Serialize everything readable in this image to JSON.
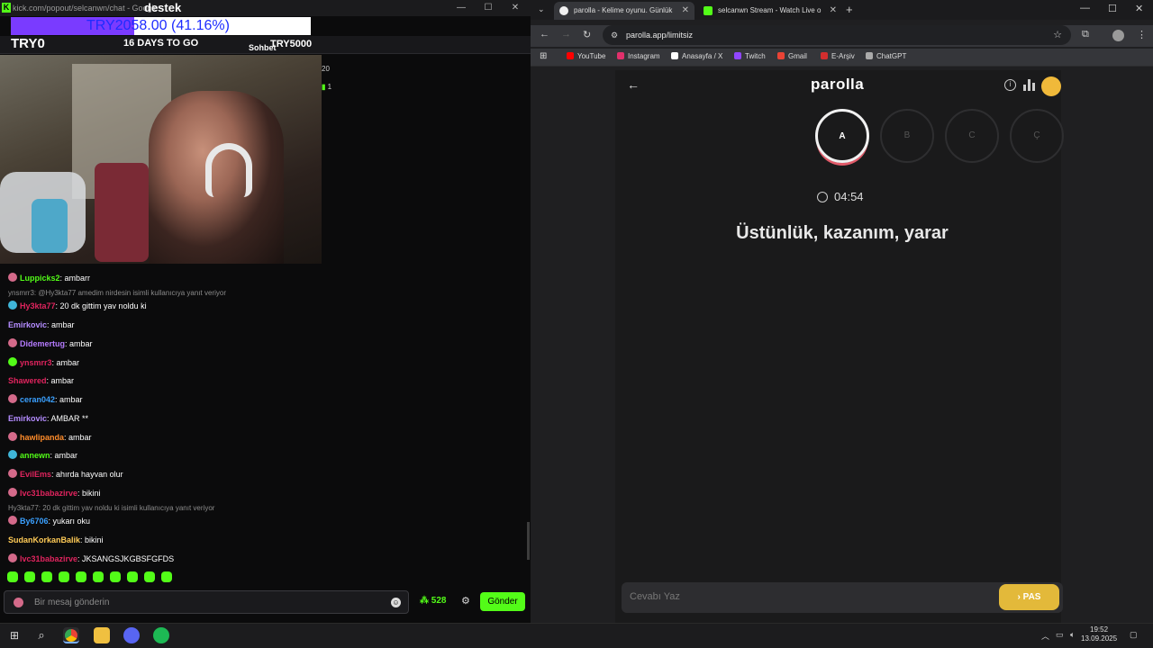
{
  "left_window": {
    "title": "kick.com/popout/selcanwn/chat - Google",
    "overlay": {
      "destek": "destek",
      "goal_text": "TRY2058.00 (41.16%)",
      "goal_progress": 0.4116,
      "left_amount": "TRY0",
      "days_left": "16 DAYS TO GO",
      "chat_label": "Sohbet",
      "goal_amount": "TRY5000"
    },
    "side_stub": {
      "top": "20",
      "count": "1"
    },
    "chat": {
      "messages": [
        {
          "user": "Luppicks2",
          "text": ": ambarr",
          "color": "#53fc18",
          "badge": "#d46a8a"
        },
        {
          "reply": "ynsmrr3: @Hy3kta77 amedim nirdesin isimli kullanıcıya yanıt veriyor"
        },
        {
          "user": "Hy3kta77",
          "text": ": 20 dk gittim yav noldu ki",
          "color": "#e0245e",
          "badge": "#3fb5d8"
        },
        {
          "user": "Emirkovic",
          "text": ": ambar",
          "color": "#b48cff",
          "badge": ""
        },
        {
          "user": "Didemertug",
          "text": ": ambar",
          "color": "#b57bff",
          "badge": "#d46a8a"
        },
        {
          "user": "ynsmrr3",
          "text": ": ambar",
          "color": "#e0245e",
          "badge": "#53fc18"
        },
        {
          "user": "Shawered",
          "text": ": ambar",
          "color": "#e0245e",
          "badge": ""
        },
        {
          "user": "ceran042",
          "text": ": ambar",
          "color": "#3aa0ff",
          "badge": "#d46a8a"
        },
        {
          "user": "Emirkovic",
          "text": ": AMBAR **",
          "color": "#b48cff",
          "badge": ""
        },
        {
          "user": "hawlipanda",
          "text": ": ambar",
          "color": "#ff8c2a",
          "badge": "#d46a8a"
        },
        {
          "user": "annewn",
          "text": ": ambar",
          "color": "#53fc18",
          "badge": "#3fb5d8"
        },
        {
          "user": "EvilEms",
          "text": ": ahırda hayvan olur",
          "color": "#e0245e",
          "badge": "#d46a8a"
        },
        {
          "user": "lvc31babazirve",
          "text": ": bikini",
          "color": "#e0245e",
          "badge": "#d46a8a"
        },
        {
          "reply": "Hy3kta77: 20 dk gittim yav noldu ki isimli kullanıcıya yanıt veriyor"
        },
        {
          "user": "By6706",
          "text": ": yukarı oku",
          "color": "#3aa0ff",
          "badge": "#d46a8a"
        },
        {
          "user": "SudanKorkanBalik",
          "text": ": bikini",
          "color": "#ffcb57",
          "badge": ""
        },
        {
          "user": "lvc31babazirve",
          "text": ": JKSANGSJKGBSFGFDS",
          "color": "#e0245e",
          "badge": "#d46a8a"
        }
      ],
      "input_placeholder": "Bir mesaj gönderin",
      "points": "528",
      "send_label": "Gönder"
    }
  },
  "right_window": {
    "tabs": [
      {
        "label": "parolla - Kelime oyunu. Günlük",
        "active": true,
        "fav_color": "#f1f1f1"
      },
      {
        "label": "selcanwn Stream - Watch Live o",
        "active": false,
        "fav_color": "#53fc18"
      }
    ],
    "url": "parolla.app/limitsiz",
    "bookmarks": [
      {
        "label": "YouTube",
        "color": "#ff0000"
      },
      {
        "label": "Instagram",
        "color": "#e1306c"
      },
      {
        "label": "Anasayfa / X",
        "color": "#ffffff"
      },
      {
        "label": "Twitch",
        "color": "#9146ff"
      },
      {
        "label": "Gmail",
        "color": "#ea4335"
      },
      {
        "label": "E-Arşiv",
        "color": "#d22e2e"
      },
      {
        "label": "ChatGPT",
        "color": "#aaaaaa"
      }
    ],
    "app": {
      "brand": "parolla",
      "info_icon": "i",
      "letters": [
        "A",
        "B",
        "C",
        "Ç"
      ],
      "active_letter": "A",
      "timer": "04:54",
      "clue": "Üstünlük, kazanım, yarar",
      "answer_placeholder": "Cevabı Yaz",
      "pass_label": "PAS"
    }
  },
  "taskbar": {
    "time": "19:52",
    "date": "13.09.2025"
  }
}
